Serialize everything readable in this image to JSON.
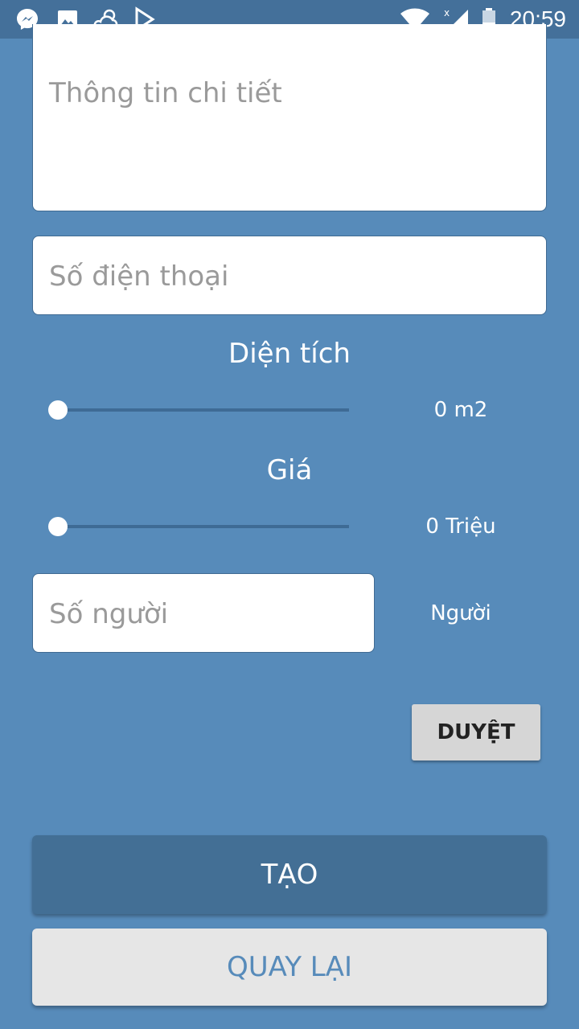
{
  "status_bar": {
    "time": "20:59",
    "icons": [
      "messenger-icon",
      "image-icon",
      "weather-icon",
      "play-store-icon",
      "wifi-icon",
      "signal-icon",
      "battery-icon"
    ]
  },
  "form": {
    "details_placeholder": "Thông tin chi tiết",
    "phone_placeholder": "Số điện thoại",
    "area_label": "Diện tích",
    "area_value": "0 m2",
    "area_slider_fraction": 0,
    "price_label": "Giá",
    "price_value": "0 Triệu",
    "price_slider_fraction": 0,
    "people_placeholder": "Số người",
    "people_unit": "Người",
    "duyet_label": "DUYỆT",
    "create_label": "TẠO",
    "back_label": "QUAY LẠI"
  },
  "colors": {
    "background": "#578bba",
    "status_bar": "#44709a",
    "primary_button": "#436f95",
    "secondary_button": "#e6e6e6"
  }
}
